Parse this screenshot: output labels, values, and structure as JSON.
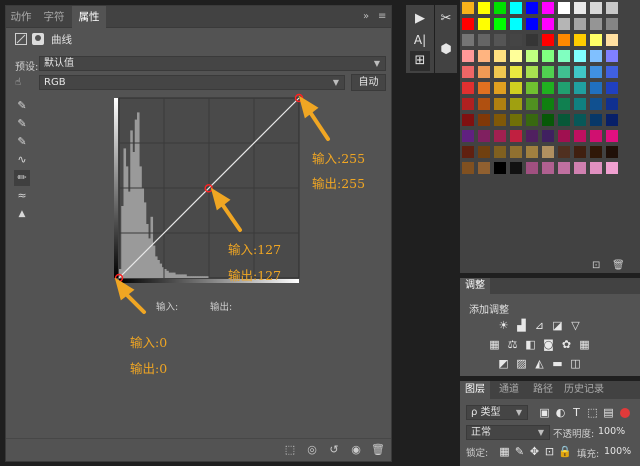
{
  "props_panel": {
    "tabs": [
      "动作",
      "字符",
      "属性"
    ],
    "active_tab": "属性",
    "collapse_label": "»",
    "menu_label": "≡",
    "close_label": "×",
    "title": "曲线",
    "preset_label": "预设:",
    "preset_value": "默认值",
    "channel_value": "RGB",
    "auto_label": "自动",
    "input_label": "输入:",
    "output_label": "输出:"
  },
  "annotations": {
    "white_point": {
      "input": "输入:255",
      "output": "输出:255"
    },
    "midpoint": {
      "input": "输入:127",
      "output": "输出:127"
    },
    "black_point": {
      "input": "输入:0",
      "output": "输出:0"
    },
    "color": "#f0a623"
  },
  "chart_data": {
    "type": "line",
    "xlim": [
      0,
      255
    ],
    "ylim": [
      0,
      255
    ],
    "series": [
      {
        "x": [
          0,
          127,
          255
        ],
        "y": [
          0,
          127,
          255
        ]
      }
    ],
    "control_points": [
      [
        0,
        0
      ],
      [
        127,
        127
      ],
      [
        255,
        255
      ]
    ],
    "histogram_bins": [
      0.05,
      0.4,
      0.72,
      0.62,
      0.48,
      0.82,
      0.7,
      0.88,
      0.92,
      0.62,
      0.5,
      0.42,
      0.3,
      0.22,
      0.34,
      0.18,
      0.12,
      0.1,
      0.08,
      0.06,
      0.05,
      0.04,
      0.03,
      0.03,
      0.03,
      0.02,
      0.02,
      0.02,
      0.02,
      0.02,
      0.01,
      0.01,
      0.01,
      0.01,
      0.01,
      0.01,
      0.01,
      0.01,
      0.01,
      0.01
    ]
  },
  "right": {
    "adjustments_tab": "调整",
    "adjustments_title": "添加调整",
    "layers_tabs": [
      "图层",
      "通道",
      "路径",
      "历史记录"
    ],
    "filter_label": "ρ 类型",
    "blend_mode": "正常",
    "opacity_label": "不透明度:",
    "opacity_value": "100%",
    "lock_label": "锁定:",
    "fill_label": "填充:",
    "fill_value": "100%"
  },
  "swatch_colors": [
    [
      "#f7b21b",
      "#ffff00",
      "#00e000",
      "#00ffff",
      "#0000ff",
      "#ff00ff",
      "#ffffff",
      "#e8e8e8",
      "#d8d8d8",
      "#c8c8c8"
    ],
    [
      "#ff0000",
      "#ffff00",
      "#00ff00",
      "#00ffff",
      "#0000ff",
      "#ff00ff",
      "#b5b5b5",
      "#a5a5a5",
      "#959595",
      "#858585"
    ],
    [
      "#757575",
      "#656565",
      "#555555",
      "#454545",
      "#353535",
      "#ff0000",
      "#ff8800",
      "#ffcc00",
      "#ffff66",
      "#ffe0a0"
    ],
    [
      "#ff9999",
      "#ffb480",
      "#ffe080",
      "#ffff99",
      "#c0ff80",
      "#80ff80",
      "#80ffc0",
      "#80ffff",
      "#80c0ff",
      "#8080ff"
    ],
    [
      "#ee6666",
      "#f09a55",
      "#f0c850",
      "#e8e840",
      "#a8e050",
      "#50d050",
      "#40c090",
      "#40c8c8",
      "#4090e0",
      "#4060e0"
    ],
    [
      "#e03030",
      "#e07020",
      "#e0a020",
      "#d0d020",
      "#70c030",
      "#20b020",
      "#20a070",
      "#20a0a0",
      "#2070c0",
      "#2040c0"
    ],
    [
      "#b02020",
      "#b05010",
      "#b08010",
      "#a0a010",
      "#509020",
      "#108010",
      "#108050",
      "#108080",
      "#105090",
      "#103090"
    ],
    [
      "#801010",
      "#803808",
      "#805808",
      "#707008",
      "#386810",
      "#085808",
      "#085838",
      "#085858",
      "#083868",
      "#082068"
    ],
    [
      "#602080",
      "#802060",
      "#a02050",
      "#c02040",
      "#502060",
      "#402060",
      "#a01050",
      "#c01060",
      "#d01070",
      "#e01080"
    ],
    [
      "#602010",
      "#704010",
      "#806020",
      "#907030",
      "#a08040",
      "#b09060",
      "#503020",
      "#402010",
      "#301808",
      "#201008"
    ],
    [
      "#805020",
      "#906030",
      "#000000",
      "#111111",
      "#a05080",
      "#b06090",
      "#c070a0",
      "#d080b0",
      "#e090c0",
      "#f0a0d0"
    ]
  ]
}
